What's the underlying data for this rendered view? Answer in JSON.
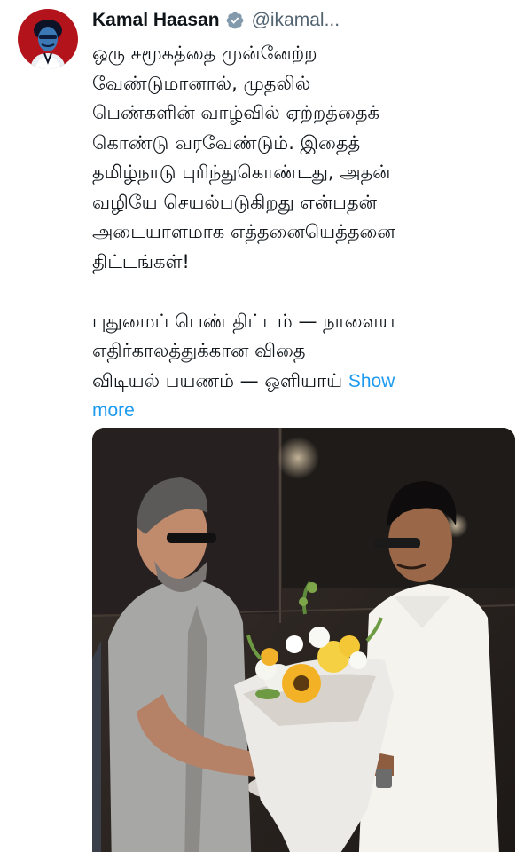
{
  "author": {
    "display_name": "Kamal Haasan",
    "handle": "@ikamal...",
    "verified_icon": "verified-badge-icon",
    "avatar_icon": "avatar-illustration"
  },
  "tweet": {
    "lines": [
      "ஒரு சமூகத்தை முன்னேற்ற",
      "வேண்டுமானால், முதலில்",
      "பெண்களின் வாழ்வில் ஏற்றத்தைக்",
      "கொண்டு வரவேண்டும்.  இதைத்",
      "தமிழ்நாடு புரிந்துகொண்டது, அதன்",
      "வழியே செயல்படுகிறது என்பதன்",
      "அடையாளமாக எத்தனையெத்தனை",
      "திட்டங்கள்!",
      "புதுமைப் பெண் திட்டம் — நாளைய",
      "எதிர்காலத்துக்கான விதை",
      "விடியல் பயணம் — ஒளியாய்"
    ],
    "show_more_part1": "Show",
    "show_more_part2": "more"
  },
  "colors": {
    "link": "#1d9bf0",
    "verified": "#829aab",
    "text": "#0f1419",
    "secondary_text": "#536471"
  },
  "media": {
    "kind": "photo",
    "description_icon": "photo-of-two-men-with-bouquet"
  }
}
